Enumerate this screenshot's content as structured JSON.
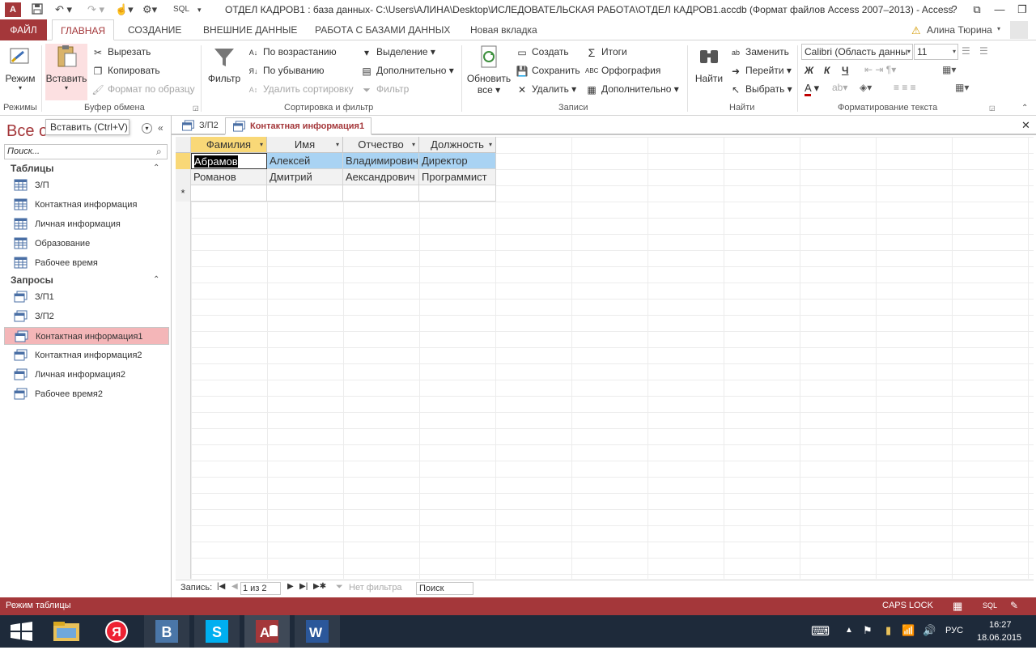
{
  "window": {
    "title": "ОТДЕЛ КАДРОВ1 : база данных- C:\\Users\\АЛИНА\\Desktop\\ИСЛЕДОВАТЕЛЬСКАЯ РАБОТА\\ОТДЕЛ КАДРОВ1.accdb (Формат файлов Access 2007–2013) - Access",
    "help": "?",
    "sql": "SQL"
  },
  "ribbon_tabs": [
    "ФАЙЛ",
    "ГЛАВНАЯ",
    "СОЗДАНИЕ",
    "ВНЕШНИЕ ДАННЫЕ",
    "РАБОТА С БАЗАМИ ДАННЫХ",
    "Новая вкладка"
  ],
  "user": "Алина Тюрина",
  "ribbon": {
    "views": {
      "view_label": "Режим",
      "group": "Режимы"
    },
    "clipboard": {
      "paste": "Вставить",
      "cut": "Вырезать",
      "copy": "Копировать",
      "format_painter": "Формат по образцу",
      "group": "Буфер обмена"
    },
    "sort": {
      "filter": "Фильтр",
      "ascending": "По возрастанию",
      "descending": "По убыванию",
      "remove_sort": "Удалить сортировку",
      "selection": "Выделение",
      "advanced": "Дополнительно",
      "toggle_filter": "Фильтр",
      "group": "Сортировка и фильтр"
    },
    "records": {
      "refresh": "Обновить",
      "refresh2": "все",
      "new": "Создать",
      "save": "Сохранить",
      "delete": "Удалить",
      "totals": "Итоги",
      "spelling": "Орфография",
      "more": "Дополнительно",
      "group": "Записи"
    },
    "find": {
      "find": "Найти",
      "replace": "Заменить",
      "goto": "Перейти",
      "select": "Выбрать",
      "group": "Найти"
    },
    "text": {
      "font": "Calibri (Область данны",
      "size": "11",
      "bold": "Ж",
      "italic": "К",
      "underline": "Ч",
      "group": "Форматирование текста"
    }
  },
  "tooltip": "Вставить (Ctrl+V)",
  "nav": {
    "header": "Все о",
    "search_placeholder": "Поиск...",
    "tables_label": "Таблицы",
    "tables": [
      "З/П",
      "Контактная информация",
      "Личная информация",
      "Образование",
      "Рабочее время"
    ],
    "queries_label": "Запросы",
    "queries": [
      "З/П1",
      "З/П2",
      "Контактная информация1",
      "Контактная информация2",
      "Личная информация2",
      "Рабочее время2"
    ]
  },
  "doc_tabs": [
    "З/П2",
    "Контактная информация1"
  ],
  "table": {
    "columns": [
      "Фамилия",
      "Имя",
      "Отчество",
      "Должность"
    ],
    "rows": [
      [
        "Абрамов",
        "Алексей",
        "Владимирович",
        "Директор"
      ],
      [
        "Романов",
        "Дмитрий",
        "Аександрович",
        "Программист"
      ]
    ],
    "new_row_marker": "*"
  },
  "record_nav": {
    "label": "Запись:",
    "position": "1 из 2",
    "filter": "Нет фильтра",
    "search": "Поиск"
  },
  "status": {
    "mode": "Режим таблицы",
    "caps": "CAPS LOCK",
    "sql": "SQL"
  },
  "taskbar": {
    "lang": "РУС",
    "time": "16:27",
    "date": "18.06.2015"
  },
  "colors": {
    "accent": "#a4373a",
    "selected_row": "#a9d3f3",
    "active_header": "#f9d877"
  }
}
